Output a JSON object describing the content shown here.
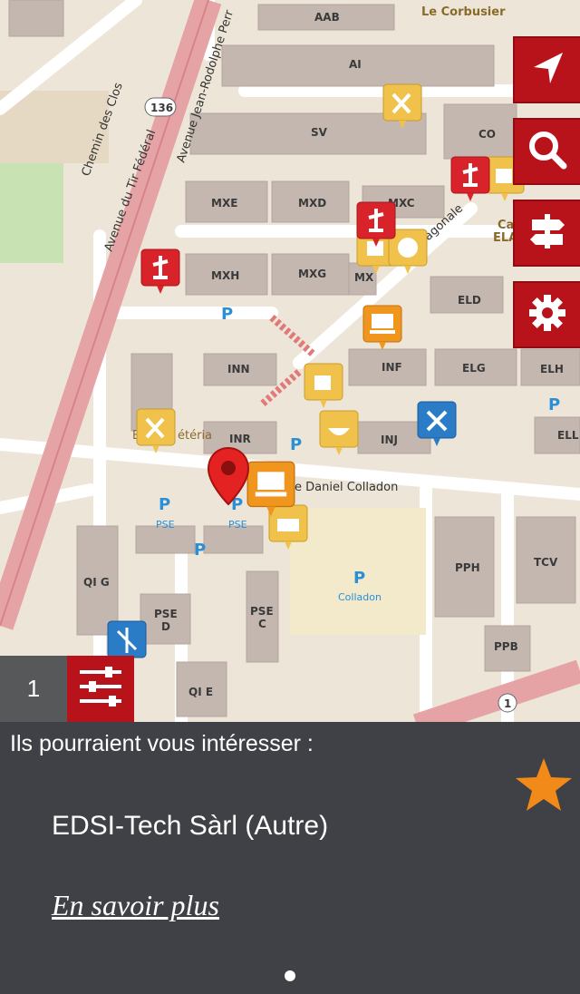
{
  "map": {
    "buildings": [
      "AAB",
      "AI",
      "SV",
      "CO",
      "MXE",
      "MXD",
      "MXC",
      "MXH",
      "MXG",
      "MX",
      "ELD",
      "INN",
      "INF",
      "ELG",
      "ELH",
      "INR",
      "INJ",
      "ELL",
      "PPH",
      "TCV",
      "PPB",
      "QI G",
      "PSE D",
      "PSE C",
      "QI E"
    ],
    "places": [
      "Le Corbusier",
      "Cafét",
      "ELA",
      "B",
      "étéria"
    ],
    "roads": [
      "Chemin des Clos",
      "Avenue du Tir Fédéral",
      "Avenue Jean-Rodolphe Perr",
      "iagonale",
      "e Daniel Colladon"
    ],
    "road_numbers": [
      "136",
      "1"
    ],
    "parking": [
      "P",
      "PSE",
      "PSE",
      "Colladon"
    ]
  },
  "controls": {
    "locate_icon": "location-arrow-icon",
    "search_icon": "magnifier-icon",
    "directions_icon": "signpost-icon",
    "settings_icon": "gear-icon",
    "filter_icon": "sliders-icon"
  },
  "result_count": "1",
  "panel": {
    "heading": "Ils pourraient vous intéresser :",
    "name": "EDSI-Tech Sàrl  (Autre)",
    "link": "En savoir plus",
    "favorite_icon": "star-icon"
  },
  "colors": {
    "accent_red": "#b8121b",
    "panel_bg": "#3f4146",
    "star": "#f28a1a",
    "poi_yellow": "#f0c24b",
    "poi_orange": "#f0961e",
    "poi_blue": "#2a7cc7"
  }
}
